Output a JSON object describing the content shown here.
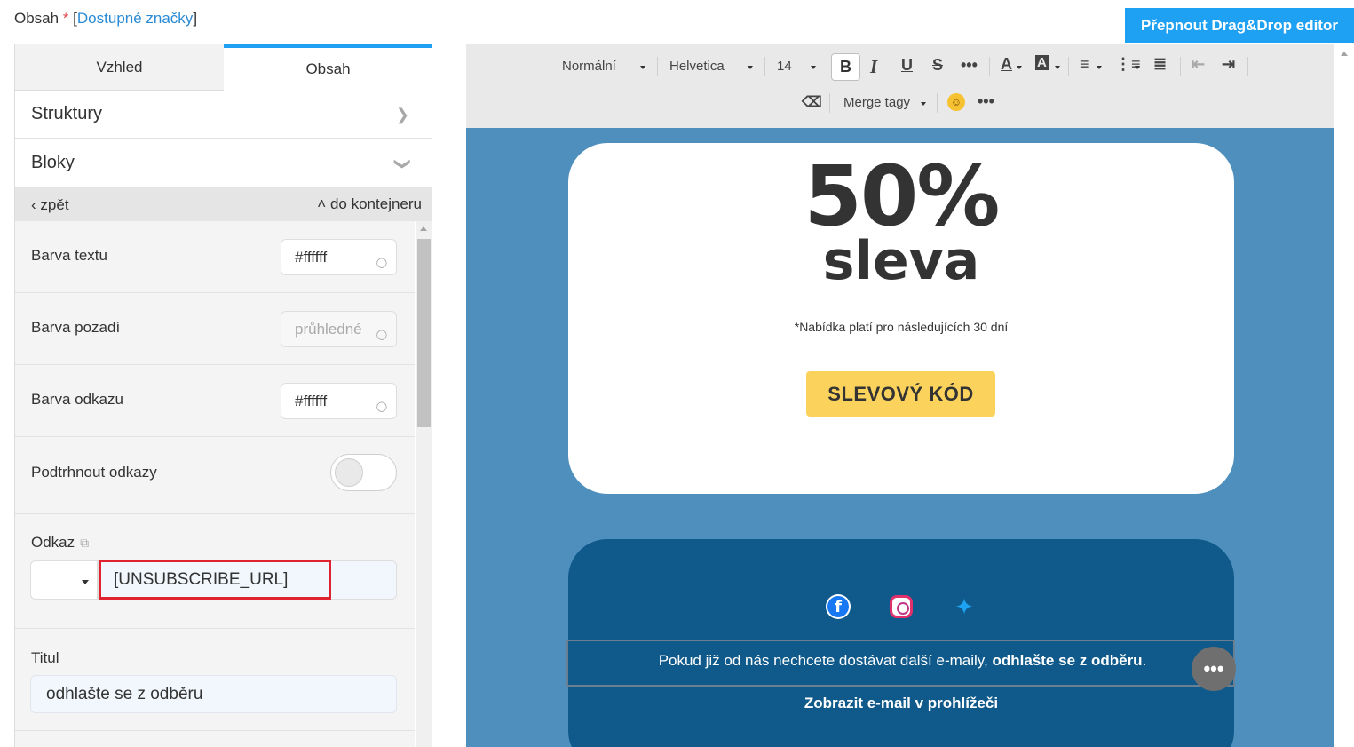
{
  "header": {
    "label": "Obsah",
    "required_mark": "*",
    "tags_link": "Dostupné značky",
    "switch_button": "Přepnout Drag&Drop editor"
  },
  "left": {
    "tabs": [
      "Vzhled",
      "Obsah"
    ],
    "active_tab": "Obsah",
    "sections": [
      {
        "label": "Struktury",
        "chevron": "chevron-right-icon"
      },
      {
        "label": "Bloky",
        "chevron": "chevron-down-icon"
      }
    ],
    "nav": {
      "back": "zpět",
      "up": "do kontejneru"
    },
    "fields": {
      "text_color": {
        "label": "Barva textu",
        "value": "#ffffff"
      },
      "bg_color": {
        "label": "Barva pozadí",
        "value": "průhledné"
      },
      "link_color": {
        "label": "Barva odkazu",
        "value": "#ffffff"
      },
      "underline": {
        "label": "Podtrhnout odkazy",
        "on": false
      },
      "link": {
        "label": "Odkaz",
        "value": "[UNSUBSCRIBE_URL]"
      },
      "title": {
        "label": "Titul",
        "value": "odhlašte se z odběru"
      }
    }
  },
  "toolbar": {
    "style": "Normální",
    "font": "Helvetica",
    "size": "14",
    "bold": "B",
    "italic": "I",
    "underline": "U",
    "strike": "S",
    "merge_tags": "Merge tagy"
  },
  "email": {
    "headline_big": "50%",
    "headline_sub": "sleva",
    "offer_note": "*Nabídka platí pro následujících 30 dní",
    "code_button": "SLEVOVÝ KÓD",
    "unsub_prefix": "Pokud již od nás nechcete dostávat další e-maily,",
    "unsub_link": "odhlašte se z odběru",
    "unsub_suffix": ".",
    "view_in_browser": "Zobrazit e-mail v prohlížeči",
    "colors": {
      "canvas": "#4e8fbd",
      "footer": "#0f5a8a",
      "button": "#fbd35c",
      "accent": "#1ea1f2"
    }
  }
}
